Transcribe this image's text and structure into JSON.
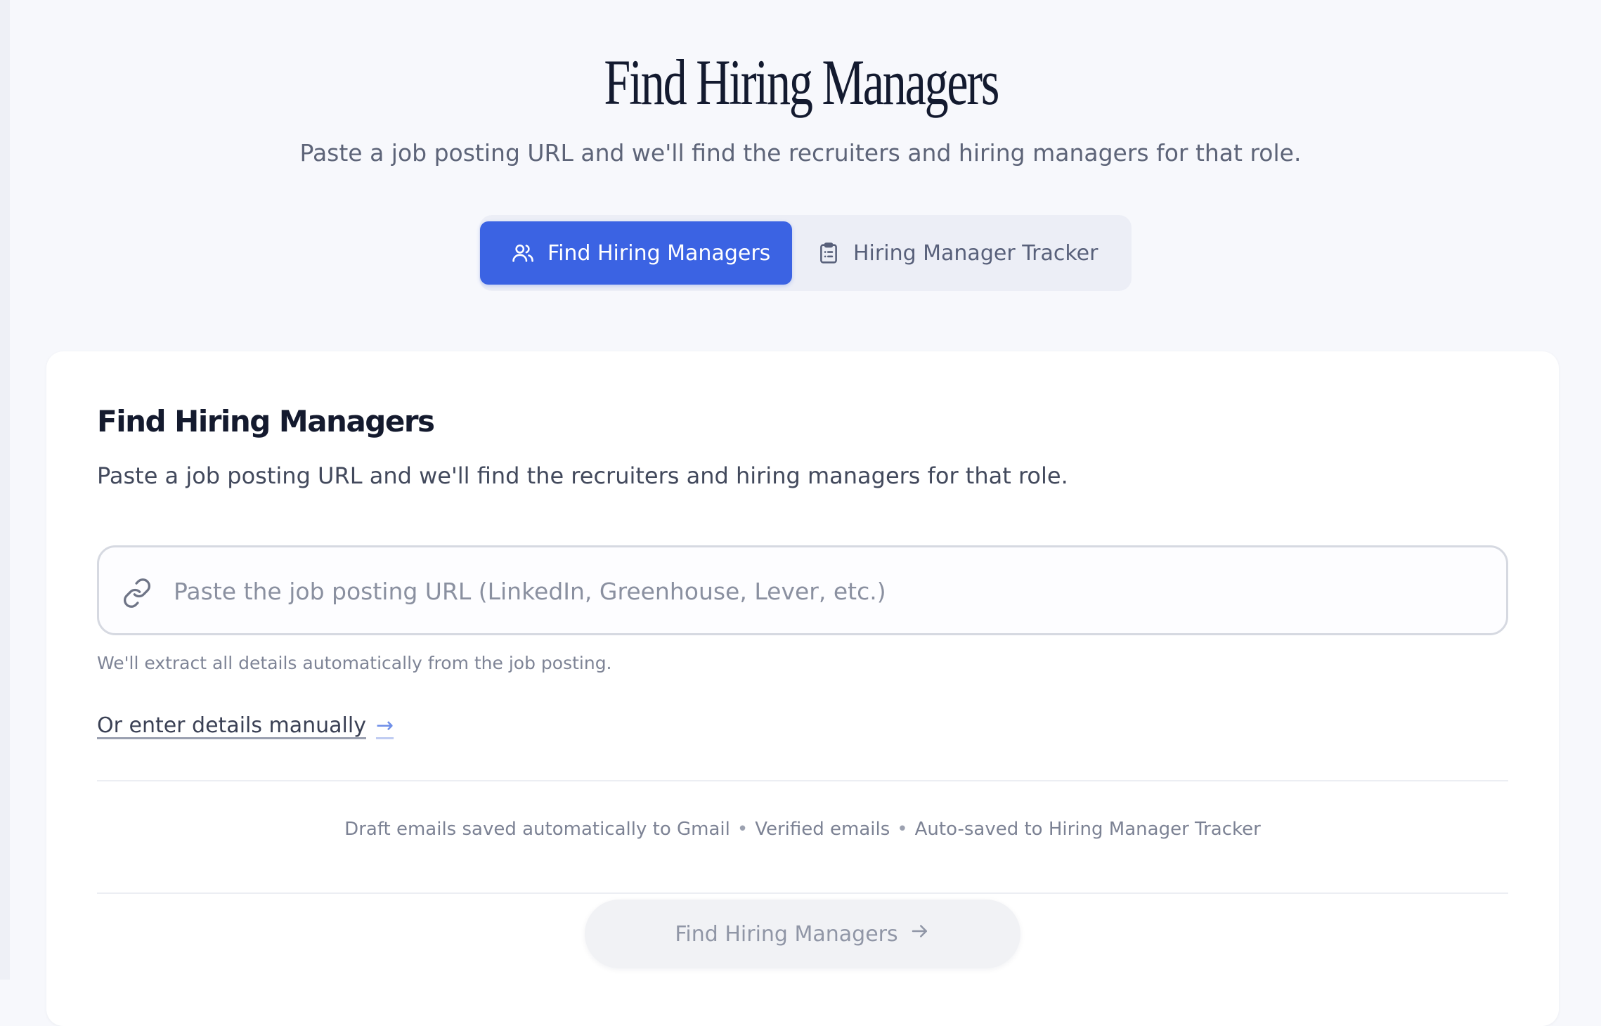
{
  "hero": {
    "title": "Find Hiring Managers",
    "subtitle": "Paste a job posting URL and we'll find the recruiters and hiring managers for that role."
  },
  "tabs": [
    {
      "label": "Find Hiring Managers",
      "icon": "users-icon",
      "active": true
    },
    {
      "label": "Hiring Manager Tracker",
      "icon": "clipboard-list-icon",
      "active": false
    }
  ],
  "card": {
    "title": "Find Hiring Managers",
    "subtitle": "Paste a job posting URL and we'll find the recruiters and hiring managers for that role.",
    "url_input": {
      "value": "",
      "placeholder": "Paste the job posting URL (LinkedIn, Greenhouse, Lever, etc.)",
      "icon": "link-icon"
    },
    "helper_text": "We'll extract all details automatically from the job posting.",
    "manual_link": {
      "label": "Or enter details manually",
      "arrow": "→"
    },
    "features": [
      "Draft emails saved automatically to Gmail",
      "Verified emails",
      "Auto-saved to Hiring Manager Tracker"
    ],
    "features_separator": "•",
    "submit_button": {
      "label": "Find Hiring Managers",
      "icon": "arrow-right-icon",
      "disabled": true
    }
  },
  "colors": {
    "background": "#f7f8fc",
    "accent": "#3b63e3",
    "card": "#ffffff",
    "tab_bar": "#eceef6"
  }
}
